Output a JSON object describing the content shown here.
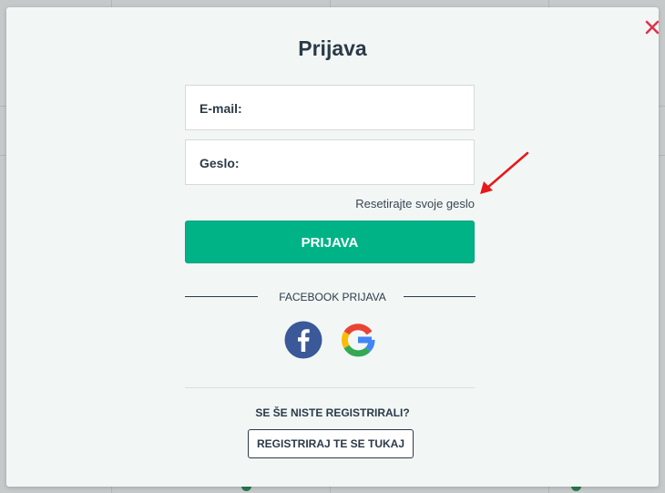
{
  "modal": {
    "title": "Prijava",
    "email_label": "E-mail:",
    "email_value": "",
    "password_label": "Geslo:",
    "password_value": "",
    "reset_link": "Resetirajte svoje geslo",
    "login_button": "PRIJAVA",
    "facebook_divider": "FACEBOOK PRIJAVA",
    "not_registered": "SE ŠE NISTE REGISTRIRALI?",
    "register_button": "REGISTRIRAJ TE SE TUKAJ"
  },
  "icons": {
    "close": "close-icon",
    "facebook": "facebook-icon",
    "google": "google-icon",
    "annotation_arrow": "red-arrow-icon"
  },
  "colors": {
    "accent": "#00b386",
    "text_dark": "#2b3a48",
    "close_red": "#e0344a",
    "arrow_red": "#e8191b",
    "facebook_blue": "#3b5998"
  }
}
